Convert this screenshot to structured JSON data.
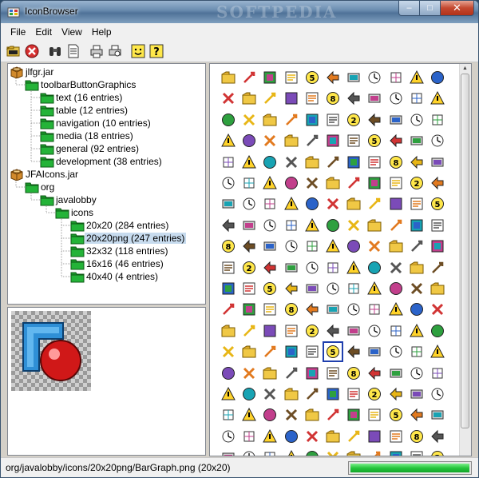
{
  "window": {
    "title": "IconBrowser",
    "watermark": "SOFTPEDIA",
    "minimize_label": "–",
    "maximize_label": "□",
    "close_label": "✕"
  },
  "menu": [
    "File",
    "Edit",
    "View",
    "Help"
  ],
  "toolbar": [
    {
      "name": "open-icon",
      "group": 0
    },
    {
      "name": "stop-icon",
      "group": 0
    },
    {
      "name": "binoculars-icon",
      "group": 1
    },
    {
      "name": "document-icon",
      "group": 1
    },
    {
      "name": "print-icon",
      "group": 2
    },
    {
      "name": "print-preview-icon",
      "group": 2
    },
    {
      "name": "about-icon",
      "group": 3
    },
    {
      "name": "help-icon",
      "group": 3
    }
  ],
  "tree": [
    {
      "label": "jlfgr.jar",
      "level": 0,
      "type": "jar"
    },
    {
      "label": "toolbarButtonGraphics",
      "level": 1,
      "type": "folder"
    },
    {
      "label": "text (16 entries)",
      "level": 2,
      "type": "folder"
    },
    {
      "label": "table (12 entries)",
      "level": 2,
      "type": "folder"
    },
    {
      "label": "navigation (10 entries)",
      "level": 2,
      "type": "folder"
    },
    {
      "label": "media (18 entries)",
      "level": 2,
      "type": "folder"
    },
    {
      "label": "general (92 entries)",
      "level": 2,
      "type": "folder"
    },
    {
      "label": "development (38 entries)",
      "level": 2,
      "type": "folder"
    },
    {
      "label": "JFAIcons.jar",
      "level": 0,
      "type": "jar"
    },
    {
      "label": "org",
      "level": 1,
      "type": "folder"
    },
    {
      "label": "javalobby",
      "level": 2,
      "type": "folder"
    },
    {
      "label": "icons",
      "level": 3,
      "type": "folder"
    },
    {
      "label": "20x20 (284 entries)",
      "level": 4,
      "type": "folder"
    },
    {
      "label": "20x20png (247 entries)",
      "level": 4,
      "type": "folder",
      "selected": true
    },
    {
      "label": "32x32 (118 entries)",
      "level": 4,
      "type": "folder"
    },
    {
      "label": "16x16 (46 entries)",
      "level": 4,
      "type": "folder"
    },
    {
      "label": "40x40 (4 entries)",
      "level": 4,
      "type": "folder"
    }
  ],
  "preview": {
    "name": "bar-graph-icon-enlarged"
  },
  "icons_grid": {
    "columns": 11,
    "rows": 19,
    "selected_index": 148
  },
  "status": {
    "text": "org/javalobby/icons/20x20png/BarGraph.png (20x20)",
    "progress": 1.0
  },
  "colors": {
    "folder_green": "#1a9b2a",
    "folder_dark": "#0c5a14",
    "selection": "#c7dbee",
    "accent_blue": "#1f3fae"
  }
}
